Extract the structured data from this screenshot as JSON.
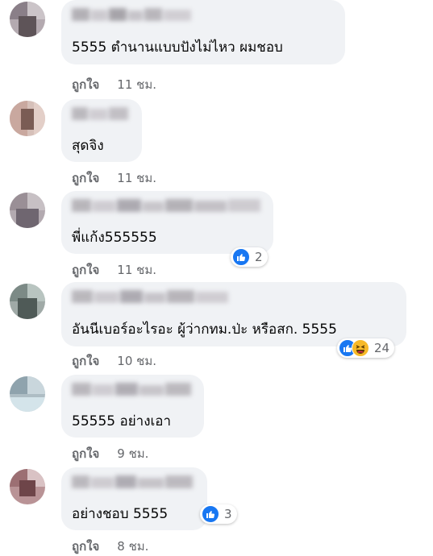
{
  "comments": [
    {
      "text": "5555 ตำนานแบบปังไม่ไหว ผมชอบ",
      "like_label": "ถูกใจ",
      "time": "11 ชม.",
      "avatar_colors": [
        "#8a7f88",
        "#cbc4c8",
        "#5e5458",
        "#a59aa0"
      ]
    },
    {
      "text": "สุดจิง",
      "like_label": "ถูกใจ",
      "time": "11 ชม.",
      "avatar_colors": [
        "#c9a89f",
        "#7a5c54",
        "#e3cfc8",
        "#9b8078"
      ]
    },
    {
      "text": "พี่แก้ง555555",
      "like_label": "ถูกใจ",
      "time": "11 ชม.",
      "avatar_colors": [
        "#9a8f96",
        "#c7c0c4",
        "#6f6670",
        "#b3aab0"
      ],
      "reactions": {
        "count": "2"
      }
    },
    {
      "text": "อันนีเบอร์อะไรอะ ผู้ว่ากทม.ป่ะ หรือสก. 5555",
      "like_label": "ถูกใจ",
      "time": "10 ชม.",
      "avatar_colors": [
        "#7c8a86",
        "#b8c4c0",
        "#4f5a57",
        "#a0aaa7"
      ],
      "reactions": {
        "count": "24"
      }
    },
    {
      "text": "55555 อย่างเอา",
      "like_label": "ถูกใจ",
      "time": "9 ชม.",
      "avatar_colors": [
        "#8fa3ad",
        "#c9d6dc",
        "#6b8893",
        "#aebdc4"
      ]
    },
    {
      "text": "อย่างชอบ 5555",
      "like_label": "ถูกใจ",
      "time": "8 ชม.",
      "avatar_colors": [
        "#9c6f73",
        "#d9c2c4",
        "#6e4549",
        "#b99396"
      ],
      "reactions": {
        "count": "3"
      }
    }
  ],
  "colors": {
    "bubble": "#f0f2f5",
    "text": "#050505",
    "meta": "#65676b",
    "like_blue": "#1877f2",
    "haha_yellow": "#f7b928"
  }
}
